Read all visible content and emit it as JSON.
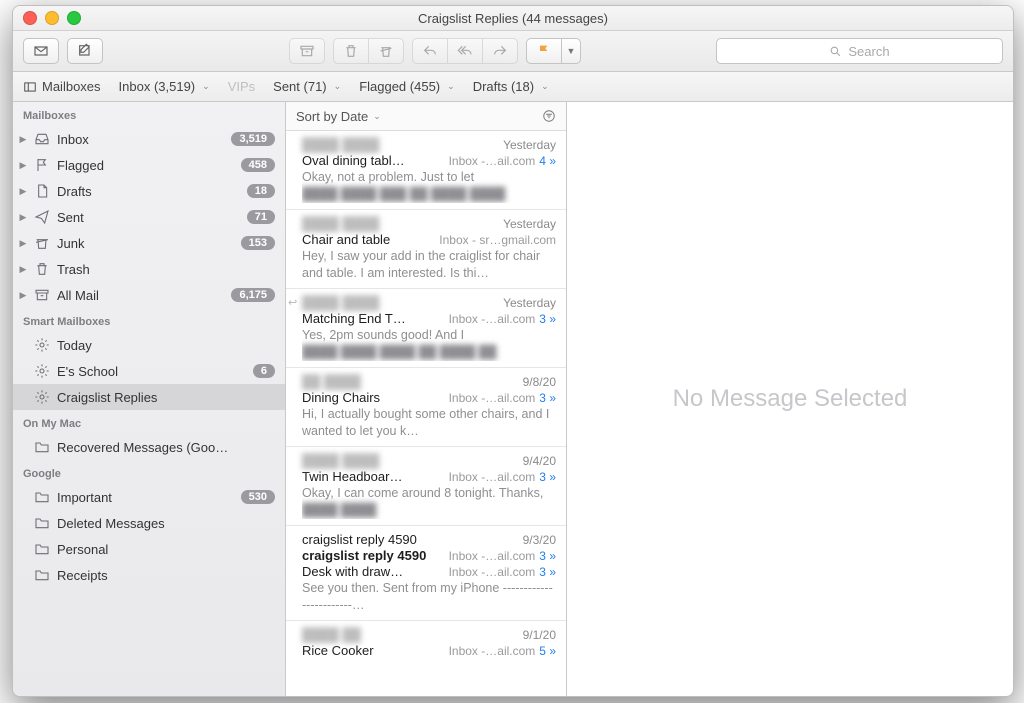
{
  "window": {
    "title": "Craigslist Replies (44 messages)"
  },
  "toolbar": {
    "search_placeholder": "Search"
  },
  "favorites": {
    "mailboxes_label": "Mailboxes",
    "inbox": "Inbox (3,519)",
    "vips": "VIPs",
    "sent": "Sent (71)",
    "flagged": "Flagged (455)",
    "drafts": "Drafts (18)"
  },
  "sidebar": {
    "sections": {
      "mailboxes": {
        "header": "Mailboxes",
        "items": [
          {
            "label": "Inbox",
            "badge": "3,519",
            "icon": "inbox"
          },
          {
            "label": "Flagged",
            "badge": "458",
            "icon": "flag"
          },
          {
            "label": "Drafts",
            "badge": "18",
            "icon": "draft"
          },
          {
            "label": "Sent",
            "badge": "71",
            "icon": "sent"
          },
          {
            "label": "Junk",
            "badge": "153",
            "icon": "junk"
          },
          {
            "label": "Trash",
            "badge": "",
            "icon": "trash"
          },
          {
            "label": "All Mail",
            "badge": "6,175",
            "icon": "archive"
          }
        ]
      },
      "smart": {
        "header": "Smart Mailboxes",
        "items": [
          {
            "label": "Today",
            "badge": "",
            "icon": "gear"
          },
          {
            "label": "E's School",
            "badge": "6",
            "icon": "gear"
          },
          {
            "label": "Craigslist Replies",
            "badge": "",
            "icon": "gear",
            "selected": true
          }
        ]
      },
      "onmymac": {
        "header": "On My Mac",
        "items": [
          {
            "label": "Recovered Messages (Goo…",
            "badge": "",
            "icon": "folder"
          }
        ]
      },
      "google": {
        "header": "Google",
        "items": [
          {
            "label": "Important",
            "badge": "530",
            "icon": "folder"
          },
          {
            "label": "Deleted Messages",
            "badge": "",
            "icon": "folder"
          },
          {
            "label": "Personal",
            "badge": "",
            "icon": "folder"
          },
          {
            "label": "Receipts",
            "badge": "",
            "icon": "folder"
          }
        ]
      }
    }
  },
  "list": {
    "sort_label": "Sort by Date",
    "messages": [
      {
        "sender": "████ ████",
        "date": "Yesterday",
        "subject": "Oval dining tabl…",
        "location": "Inbox -…ail.com",
        "count": "4",
        "preview": "Okay, not a problem. Just to let",
        "preview_blur": "████ ████ ███ ██ ████ ████"
      },
      {
        "sender": "████ ████",
        "date": "Yesterday",
        "subject": "Chair and table",
        "location": "Inbox - sr…gmail.com",
        "count": "",
        "preview": "Hey, I saw your add in the craiglist for chair and table. I am interested. Is thi…"
      },
      {
        "sender": "████ ████",
        "date": "Yesterday",
        "subject": "Matching End T…",
        "location": "Inbox -…ail.com",
        "count": "3",
        "preview": "Yes, 2pm sounds good! And I",
        "preview_blur": "████ ████ ████ ██ ████ ██",
        "reply": true
      },
      {
        "sender": "██ ████",
        "date": "9/8/20",
        "subject": "Dining Chairs",
        "location": "Inbox -…ail.com",
        "count": "3",
        "preview": "Hi, I actually bought some other chairs, and I wanted to let you k…"
      },
      {
        "sender": "████ ████",
        "date": "9/4/20",
        "subject": "Twin Headboar…",
        "location": "Inbox -…ail.com",
        "count": "3",
        "preview": "Okay, I can come around 8 tonight. Thanks,",
        "preview_blur": "████ ████"
      },
      {
        "sender": "craigslist reply 4590",
        "date": "9/3/20",
        "subject": "Desk with draw…",
        "location": "Inbox -…ail.com",
        "count": "3",
        "preview": "See you then. Sent from my iPhone ------------------------…",
        "bold": true
      },
      {
        "sender": "████ ██",
        "date": "9/1/20",
        "subject": "Rice Cooker",
        "location": "Inbox -…ail.com",
        "count": "5",
        "preview": ""
      }
    ]
  },
  "content": {
    "empty_label": "No Message Selected"
  }
}
